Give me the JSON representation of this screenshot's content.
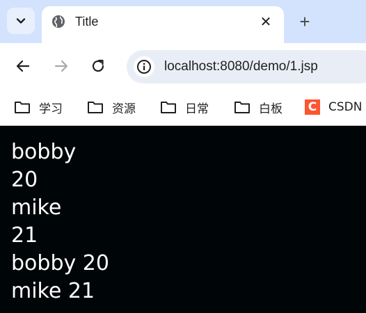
{
  "tab": {
    "title": "Title",
    "close_glyph": "✕",
    "new_tab_glyph": "+"
  },
  "omnibox": {
    "url": "localhost:8080/demo/1.jsp"
  },
  "bookmarks": [
    {
      "label": "学习",
      "icon": "folder-icon"
    },
    {
      "label": "资源",
      "icon": "folder-icon"
    },
    {
      "label": "日常",
      "icon": "folder-icon"
    },
    {
      "label": "白板",
      "icon": "folder-icon"
    },
    {
      "label": "CSDN",
      "icon": "csdn-icon",
      "icon_text": "C",
      "icon_color": "#fc5531"
    }
  ],
  "content": {
    "lines": [
      "bobby",
      "20",
      "mike",
      "21",
      "bobby 20",
      "mike 21"
    ]
  },
  "colors": {
    "tabstrip": "#d3e3fd",
    "page_background": "#000508",
    "page_text": "#ffffff"
  }
}
